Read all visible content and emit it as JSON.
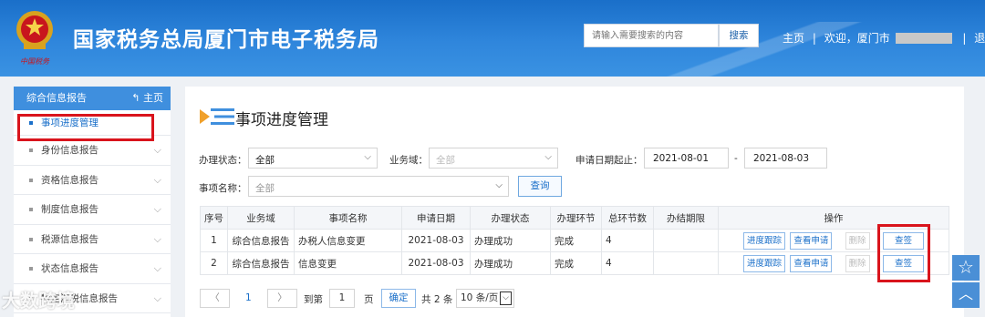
{
  "header": {
    "title": "国家税务总局厦门市电子税务局",
    "emblem_caption": "中国税务",
    "search_placeholder": "请输入需要搜索的内容",
    "search_button": "搜索",
    "home_link": "主页",
    "separator": "|",
    "welcome": "欢迎，厦门市",
    "logout": "退出"
  },
  "sidebar": {
    "header": "综合信息报告",
    "home_label": "主页",
    "items": [
      {
        "label": "事项进度管理",
        "active": true
      },
      {
        "label": "身份信息报告"
      },
      {
        "label": "资格信息报告"
      },
      {
        "label": "制度信息报告"
      },
      {
        "label": "税源信息报告"
      },
      {
        "label": "状态信息报告"
      },
      {
        "label": "特定涉税信息报告"
      }
    ]
  },
  "main": {
    "title": "事项进度管理",
    "filters": {
      "status_label": "办理状态：",
      "status_value": "全部",
      "domain_label": "业务域：",
      "domain_value": "全部",
      "date_label": "申请日期起止：",
      "date_from": "2021-08-01",
      "date_dash": "-",
      "date_to": "2021-08-03",
      "item_label": "事项名称：",
      "item_value": "全部",
      "query_button": "查询"
    },
    "table": {
      "columns": [
        "序号",
        "业务域",
        "事项名称",
        "申请日期",
        "办理状态",
        "办理环节",
        "总环节数",
        "办结期限",
        "操作"
      ],
      "rows": [
        [
          "1",
          "综合信息报告",
          "办税人信息变更",
          "2021-08-03",
          "办理成功",
          "完成",
          "4",
          ""
        ],
        [
          "2",
          "综合信息报告",
          "信息变更",
          "2021-08-03",
          "办理成功",
          "完成",
          "4",
          ""
        ]
      ],
      "actions": [
        "进度跟踪",
        "查看申请",
        "删除",
        "查签"
      ]
    },
    "pager": {
      "current_page": "1",
      "goto_label": "到第",
      "goto_value": "1",
      "page_unit": "页",
      "confirm": "确定",
      "total": "共 2 条",
      "page_size": "10 条/页"
    }
  },
  "watermark": "大数跨境",
  "colors": {
    "header_blue": "#2f86dc",
    "highlight_red": "#d9141c",
    "link_blue": "#1a6fc9"
  }
}
